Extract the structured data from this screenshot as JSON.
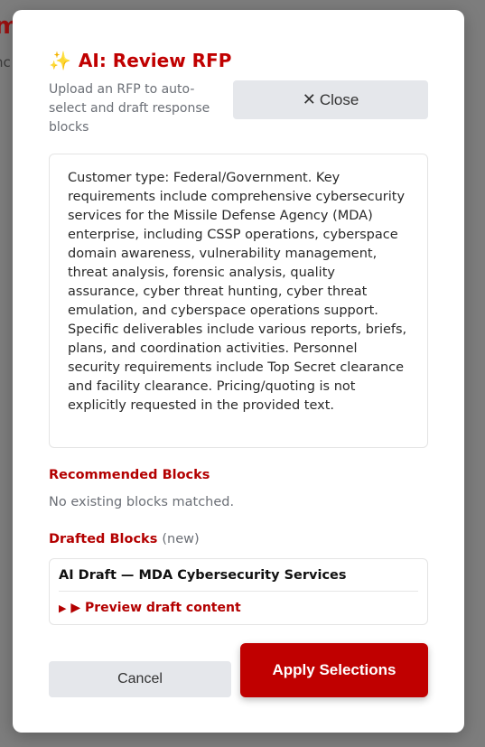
{
  "background": {
    "title_fragment": "m",
    "subtitle_fragment": "nc"
  },
  "modal": {
    "title_icon": "sparkles-icon",
    "title": "AI: Review RFP",
    "subtitle": "Upload an RFP to auto-select and draft response blocks",
    "close_label": "Close",
    "summary": "Customer type: Federal/Government. Key requirements include comprehensive cybersecurity services for the Missile Defense Agency (MDA) enterprise, including CSSP operations, cyberspace domain awareness, vulnerability management, threat analysis, forensic analysis, quality assurance, cyber threat hunting, cyber threat emulation, and cyberspace operations support. Specific deliverables include various reports, briefs, plans, and coordination activities. Personnel security requirements include Top Secret clearance and facility clearance. Pricing/quoting is not explicitly requested in the provided text.",
    "recommended": {
      "heading": "Recommended Blocks",
      "empty_text": "No existing blocks matched."
    },
    "drafted": {
      "heading": "Drafted Blocks",
      "tag": "(new)",
      "items": [
        {
          "title": "AI Draft — MDA Cybersecurity Services",
          "preview_label": "▶ Preview draft content"
        }
      ]
    },
    "cancel_label": "Cancel",
    "apply_label": "Apply Selections"
  },
  "colors": {
    "accent": "#c00000",
    "overlay": "#7d7d7d",
    "muted_text": "#6b6f76",
    "button_gray": "#e5e7eb"
  }
}
